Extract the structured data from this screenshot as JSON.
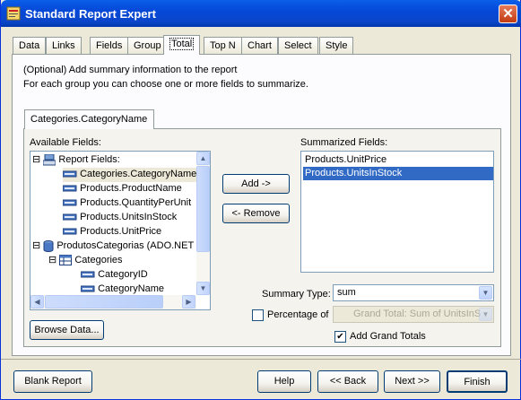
{
  "window": {
    "title": "Standard Report Expert",
    "close_label": "✕"
  },
  "tabs": [
    "Data",
    "Links",
    "Fields",
    "Group",
    "Total",
    "Top N",
    "Chart",
    "Select",
    "Style"
  ],
  "active_tab": "Total",
  "instructions": {
    "line1": "(Optional) Add summary information to the report",
    "line2": "For each group you can choose one or more fields to summarize."
  },
  "group_tab": "Categories.CategoryName",
  "available": {
    "label": "Available Fields:",
    "tree": [
      {
        "text": "Report Fields:",
        "icon": "report-fields-icon",
        "expander": "⊟"
      },
      {
        "text": "Categories.CategoryName",
        "icon": "field-icon",
        "selected": true
      },
      {
        "text": "Products.ProductName",
        "icon": "field-icon"
      },
      {
        "text": "Products.QuantityPerUnit",
        "icon": "field-icon"
      },
      {
        "text": "Products.UnitsInStock",
        "icon": "field-icon"
      },
      {
        "text": "Products.UnitPrice",
        "icon": "field-icon"
      },
      {
        "text": "ProdutosCategorias (ADO.NET",
        "icon": "database-icon",
        "expander": "⊟"
      },
      {
        "text": "Categories",
        "icon": "table-icon",
        "expander": "⊟"
      },
      {
        "text": "CategoryID",
        "icon": "field-icon"
      },
      {
        "text": "CategoryName",
        "icon": "field-icon"
      }
    ]
  },
  "buttons": {
    "add": "Add ->",
    "remove": "<- Remove",
    "browse": "Browse Data...",
    "blank": "Blank Report",
    "help": "Help",
    "back": "<< Back",
    "next": "Next >>",
    "finish": "Finish"
  },
  "summarized": {
    "label": "Summarized Fields:",
    "items": [
      "Products.UnitPrice",
      "Products.UnitsInStock"
    ],
    "selected_index": 1
  },
  "summary_type": {
    "label": "Summary Type:",
    "value": "sum"
  },
  "percentage": {
    "label": "Percentage of",
    "checked": false,
    "value": "Grand Total: Sum of UnitsInS"
  },
  "grand_totals": {
    "label": "Add Grand Totals",
    "checked": true,
    "mark": "✔"
  },
  "colors": {
    "title_bar": "#0548d8",
    "selection": "#316ac5",
    "face": "#ece9d8"
  }
}
